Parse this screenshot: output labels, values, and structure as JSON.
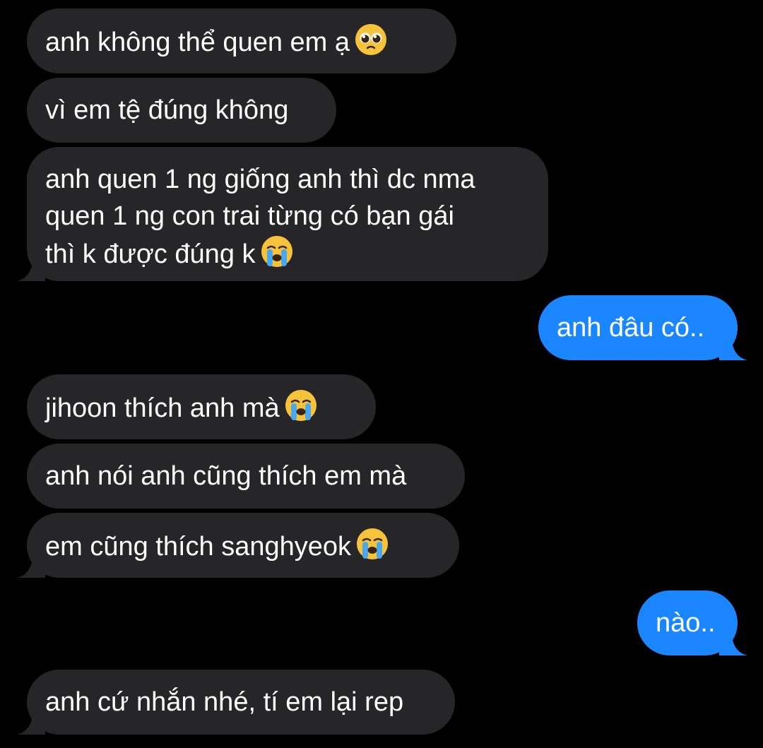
{
  "messages": [
    {
      "sender": "them",
      "text": "anh không thể quen em ạ",
      "emoji": "pleading-face"
    },
    {
      "sender": "them",
      "text": "vì em tệ đúng không"
    },
    {
      "sender": "them",
      "lines": [
        "anh quen 1 ng giống anh thì dc nma",
        "quen 1 ng con trai từng có bạn gái",
        "thì k được đúng k"
      ],
      "emoji": "loudly-crying-face"
    },
    {
      "sender": "me",
      "text": "anh đâu có.."
    },
    {
      "sender": "them",
      "text": "jihoon thích anh mà",
      "emoji": "loudly-crying-face"
    },
    {
      "sender": "them",
      "text": "anh nói anh cũng thích em mà"
    },
    {
      "sender": "them",
      "text": "em cũng thích sanghyeok",
      "emoji": "loudly-crying-face"
    },
    {
      "sender": "me",
      "text": "nào.."
    },
    {
      "sender": "them",
      "text": "anh cứ nhắn nhé, tí em lại rep"
    }
  ],
  "colors": {
    "background": "#000000",
    "received_bubble": "#262628",
    "sent_bubble": "#1a86ff",
    "text": "#ffffff"
  }
}
